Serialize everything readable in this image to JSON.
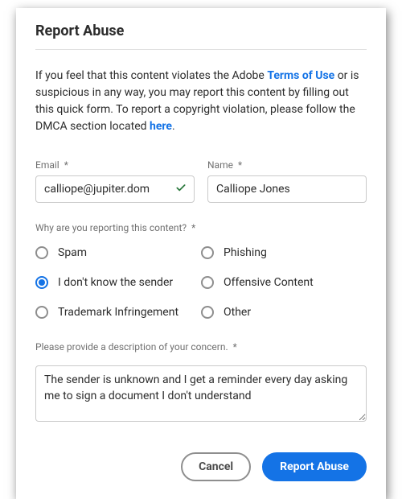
{
  "title": "Report Abuse",
  "intro": {
    "pre": "If you feel that this content violates the Adobe ",
    "terms_link": "Terms of Use",
    "mid": " or is suspicious in any way, you may report this content by filling out this quick form. To report a copyright violation, please follow the DMCA section located ",
    "here_link": "here",
    "end": "."
  },
  "fields": {
    "email_label": "Email",
    "email_value": "calliope@jupiter.dom",
    "name_label": "Name",
    "name_value": "Calliope Jones"
  },
  "asterisk": "*",
  "question": "Why are you reporting this content?",
  "reasons": [
    {
      "label": "Spam",
      "selected": false
    },
    {
      "label": "Phishing",
      "selected": false
    },
    {
      "label": "I don't know the sender",
      "selected": true
    },
    {
      "label": "Offensive Content",
      "selected": false
    },
    {
      "label": "Trademark Infringement",
      "selected": false
    },
    {
      "label": "Other",
      "selected": false
    }
  ],
  "description_label": "Please provide a description of your concern.",
  "description_value": "The sender is unknown and I get a reminder every day asking me to sign a document I don't understand",
  "buttons": {
    "cancel": "Cancel",
    "submit": "Report Abuse"
  }
}
